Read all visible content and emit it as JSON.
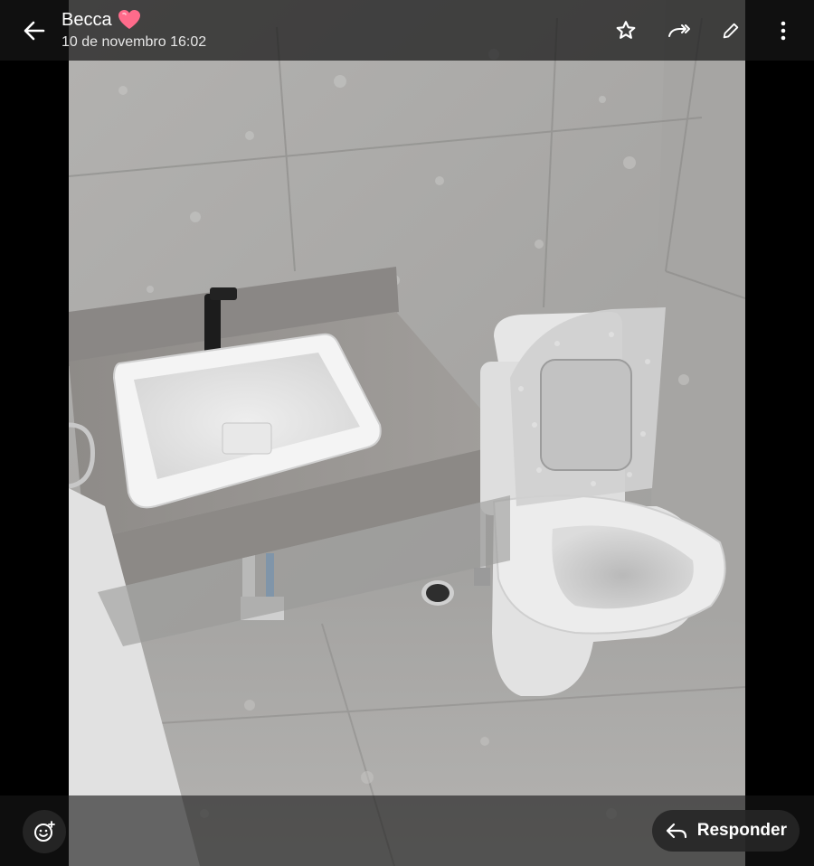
{
  "header": {
    "sender_name": "Becca",
    "timestamp": "10 de novembro 16:02",
    "back_icon": "arrow-left-icon",
    "actions": [
      {
        "name": "star",
        "icon": "star-icon"
      },
      {
        "name": "forward",
        "icon": "forward-icon"
      },
      {
        "name": "edit",
        "icon": "pencil-icon"
      },
      {
        "name": "more",
        "icon": "more-vertical-icon"
      }
    ]
  },
  "footer": {
    "emoji_icon": "emoji-add-icon",
    "reply_label": "Responder",
    "reply_icon": "reply-arrow-icon"
  },
  "colors": {
    "heart": "#ff6b8b",
    "bar_bg": "#161616",
    "text": "#ffffff"
  },
  "media": {
    "type": "photo",
    "subject": "bathroom with sink and toilet"
  }
}
